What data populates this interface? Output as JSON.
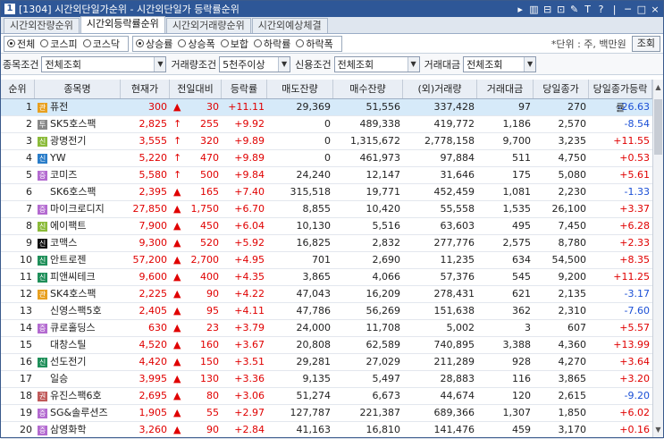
{
  "window": {
    "no": "1",
    "title": "[1304] 시간외단일가순위 - 시간외단일가 등락률순위",
    "controls": [
      "▸",
      "▥",
      "⊟",
      "⊡",
      "✎",
      "T",
      "?",
      "|",
      "─",
      "□",
      "×"
    ]
  },
  "tabs": [
    {
      "label": "시간외잔량순위",
      "active": false
    },
    {
      "label": "시간외등락률순위",
      "active": true
    },
    {
      "label": "시간외거래량순위",
      "active": false
    },
    {
      "label": "시간외예상체결",
      "active": false
    }
  ],
  "market": [
    {
      "label": "전체",
      "on": true
    },
    {
      "label": "코스피",
      "on": false
    },
    {
      "label": "코스닥",
      "on": false
    }
  ],
  "rank_type": [
    {
      "label": "상승률",
      "on": true
    },
    {
      "label": "상승폭",
      "on": false
    },
    {
      "label": "보합",
      "on": false
    },
    {
      "label": "하락률",
      "on": false
    },
    {
      "label": "하락폭",
      "on": false
    }
  ],
  "unit": "*단위 : 주, 백만원",
  "query_button": "조회",
  "filters": {
    "stock_label": "종목조건",
    "stock_value": "전체조회",
    "volume_label": "거래량조건",
    "volume_value": "5천주이상",
    "credit_label": "신용조건",
    "credit_value": "전체조회",
    "amount_label": "거래대금",
    "amount_value": "전체조회"
  },
  "columns": [
    "순위",
    "종목명",
    "현재가",
    "전일대비",
    "등락률",
    "매도잔량",
    "매수잔량",
    "(외)거래량",
    "거래대금",
    "당일종가",
    "당일종가등락률"
  ],
  "rows": [
    {
      "rank": "1",
      "mark": "관",
      "mark_color": "#e8a020",
      "name": "퓨전",
      "price": "300",
      "arrow": "▲",
      "change": "30",
      "rate": "+11.11",
      "ask": "29,369",
      "bid": "51,556",
      "volume": "337,428",
      "amount": "97",
      "close": "270",
      "close_rate": "-26.63",
      "dir": "up",
      "close_dir": "dn"
    },
    {
      "rank": "2",
      "mark": "투",
      "mark_color": "#888888",
      "name": "SK5호스팩",
      "price": "2,825",
      "arrow": "↑",
      "change": "255",
      "rate": "+9.92",
      "ask": "0",
      "bid": "489,338",
      "volume": "419,772",
      "amount": "1,186",
      "close": "2,570",
      "close_rate": "-8.54",
      "dir": "up",
      "close_dir": "dn"
    },
    {
      "rank": "3",
      "mark": "신",
      "mark_color": "#8bbb3a",
      "name": "광명전기",
      "price": "3,555",
      "arrow": "↑",
      "change": "320",
      "rate": "+9.89",
      "ask": "0",
      "bid": "1,315,672",
      "volume": "2,778,158",
      "amount": "9,700",
      "close": "3,235",
      "close_rate": "+11.55",
      "dir": "up",
      "close_dir": "up"
    },
    {
      "rank": "4",
      "mark": "신",
      "mark_color": "#2a7dc9",
      "name": "YW",
      "price": "5,220",
      "arrow": "↑",
      "change": "470",
      "rate": "+9.89",
      "ask": "0",
      "bid": "461,973",
      "volume": "97,884",
      "amount": "511",
      "close": "4,750",
      "close_rate": "+0.53",
      "dir": "up",
      "close_dir": "up"
    },
    {
      "rank": "5",
      "mark": "증",
      "mark_color": "#b36ad0",
      "name": "코미즈",
      "price": "5,580",
      "arrow": "↑",
      "change": "500",
      "rate": "+9.84",
      "ask": "24,240",
      "bid": "12,147",
      "volume": "31,646",
      "amount": "175",
      "close": "5,080",
      "close_rate": "+5.61",
      "dir": "up",
      "close_dir": "up"
    },
    {
      "rank": "6",
      "mark": "",
      "mark_color": "",
      "name": "SK6호스팩",
      "price": "2,395",
      "arrow": "▲",
      "change": "165",
      "rate": "+7.40",
      "ask": "315,518",
      "bid": "19,771",
      "volume": "452,459",
      "amount": "1,081",
      "close": "2,230",
      "close_rate": "-1.33",
      "dir": "up",
      "close_dir": "dn"
    },
    {
      "rank": "7",
      "mark": "증",
      "mark_color": "#b36ad0",
      "name": "마이크로디지",
      "price": "27,850",
      "arrow": "▲",
      "change": "1,750",
      "rate": "+6.70",
      "ask": "8,855",
      "bid": "10,420",
      "volume": "55,558",
      "amount": "1,535",
      "close": "26,100",
      "close_rate": "+3.37",
      "dir": "up",
      "close_dir": "up"
    },
    {
      "rank": "8",
      "mark": "신",
      "mark_color": "#8bbb3a",
      "name": "에이팩트",
      "price": "7,900",
      "arrow": "▲",
      "change": "450",
      "rate": "+6.04",
      "ask": "10,130",
      "bid": "5,516",
      "volume": "63,603",
      "amount": "495",
      "close": "7,450",
      "close_rate": "+6.28",
      "dir": "up",
      "close_dir": "up"
    },
    {
      "rank": "9",
      "mark": "신",
      "mark_color": "#111111",
      "name": "코맥스",
      "price": "9,300",
      "arrow": "▲",
      "change": "520",
      "rate": "+5.92",
      "ask": "16,825",
      "bid": "2,832",
      "volume": "277,776",
      "amount": "2,575",
      "close": "8,780",
      "close_rate": "+2.33",
      "dir": "up",
      "close_dir": "up"
    },
    {
      "rank": "10",
      "mark": "신",
      "mark_color": "#1f8f5a",
      "name": "안트로젠",
      "price": "57,200",
      "arrow": "▲",
      "change": "2,700",
      "rate": "+4.95",
      "ask": "701",
      "bid": "2,690",
      "volume": "11,235",
      "amount": "634",
      "close": "54,500",
      "close_rate": "+8.35",
      "dir": "up",
      "close_dir": "up"
    },
    {
      "rank": "11",
      "mark": "신",
      "mark_color": "#1f8f5a",
      "name": "피앤씨테크",
      "price": "9,600",
      "arrow": "▲",
      "change": "400",
      "rate": "+4.35",
      "ask": "3,865",
      "bid": "4,066",
      "volume": "57,376",
      "amount": "545",
      "close": "9,200",
      "close_rate": "+11.25",
      "dir": "up",
      "close_dir": "up"
    },
    {
      "rank": "12",
      "mark": "관",
      "mark_color": "#e8a020",
      "name": "SK4호스팩",
      "price": "2,225",
      "arrow": "▲",
      "change": "90",
      "rate": "+4.22",
      "ask": "47,043",
      "bid": "16,209",
      "volume": "278,431",
      "amount": "621",
      "close": "2,135",
      "close_rate": "-3.17",
      "dir": "up",
      "close_dir": "dn"
    },
    {
      "rank": "13",
      "mark": "",
      "mark_color": "",
      "name": "신영스팩5호",
      "price": "2,405",
      "arrow": "▲",
      "change": "95",
      "rate": "+4.11",
      "ask": "47,786",
      "bid": "56,269",
      "volume": "151,638",
      "amount": "362",
      "close": "2,310",
      "close_rate": "-7.60",
      "dir": "up",
      "close_dir": "dn"
    },
    {
      "rank": "14",
      "mark": "증",
      "mark_color": "#b36ad0",
      "name": "큐로홀딩스",
      "price": "630",
      "arrow": "▲",
      "change": "23",
      "rate": "+3.79",
      "ask": "24,000",
      "bid": "11,708",
      "volume": "5,002",
      "amount": "3",
      "close": "607",
      "close_rate": "+5.57",
      "dir": "up",
      "close_dir": "up"
    },
    {
      "rank": "15",
      "mark": "",
      "mark_color": "",
      "name": "대창스틸",
      "price": "4,520",
      "arrow": "▲",
      "change": "160",
      "rate": "+3.67",
      "ask": "20,808",
      "bid": "62,589",
      "volume": "740,895",
      "amount": "3,388",
      "close": "4,360",
      "close_rate": "+13.99",
      "dir": "up",
      "close_dir": "up"
    },
    {
      "rank": "16",
      "mark": "신",
      "mark_color": "#1f8f5a",
      "name": "선도전기",
      "price": "4,420",
      "arrow": "▲",
      "change": "150",
      "rate": "+3.51",
      "ask": "29,281",
      "bid": "27,029",
      "volume": "211,289",
      "amount": "928",
      "close": "4,270",
      "close_rate": "+3.64",
      "dir": "up",
      "close_dir": "up"
    },
    {
      "rank": "17",
      "mark": "",
      "mark_color": "",
      "name": "일승",
      "price": "3,995",
      "arrow": "▲",
      "change": "130",
      "rate": "+3.36",
      "ask": "9,135",
      "bid": "5,497",
      "volume": "28,883",
      "amount": "116",
      "close": "3,865",
      "close_rate": "+3.20",
      "dir": "up",
      "close_dir": "up"
    },
    {
      "rank": "18",
      "mark": "권",
      "mark_color": "#c05a5a",
      "name": "유진스팩6호",
      "price": "2,695",
      "arrow": "▲",
      "change": "80",
      "rate": "+3.06",
      "ask": "51,274",
      "bid": "6,673",
      "volume": "44,674",
      "amount": "120",
      "close": "2,615",
      "close_rate": "-9.20",
      "dir": "up",
      "close_dir": "dn"
    },
    {
      "rank": "19",
      "mark": "증",
      "mark_color": "#b36ad0",
      "name": "SG&솔루션즈",
      "price": "1,905",
      "arrow": "▲",
      "change": "55",
      "rate": "+2.97",
      "ask": "127,787",
      "bid": "221,387",
      "volume": "689,366",
      "amount": "1,307",
      "close": "1,850",
      "close_rate": "+6.02",
      "dir": "up",
      "close_dir": "up"
    },
    {
      "rank": "20",
      "mark": "증",
      "mark_color": "#b36ad0",
      "name": "삼영화학",
      "price": "3,260",
      "arrow": "▲",
      "change": "90",
      "rate": "+2.84",
      "ask": "41,163",
      "bid": "16,810",
      "volume": "141,476",
      "amount": "459",
      "close": "3,170",
      "close_rate": "+0.16",
      "dir": "up",
      "close_dir": "up"
    }
  ],
  "colors": {
    "up": "#e00000",
    "down": "#1a4fd6",
    "selected_row": "#d6eaf9",
    "titlebar": "#2e5797"
  }
}
